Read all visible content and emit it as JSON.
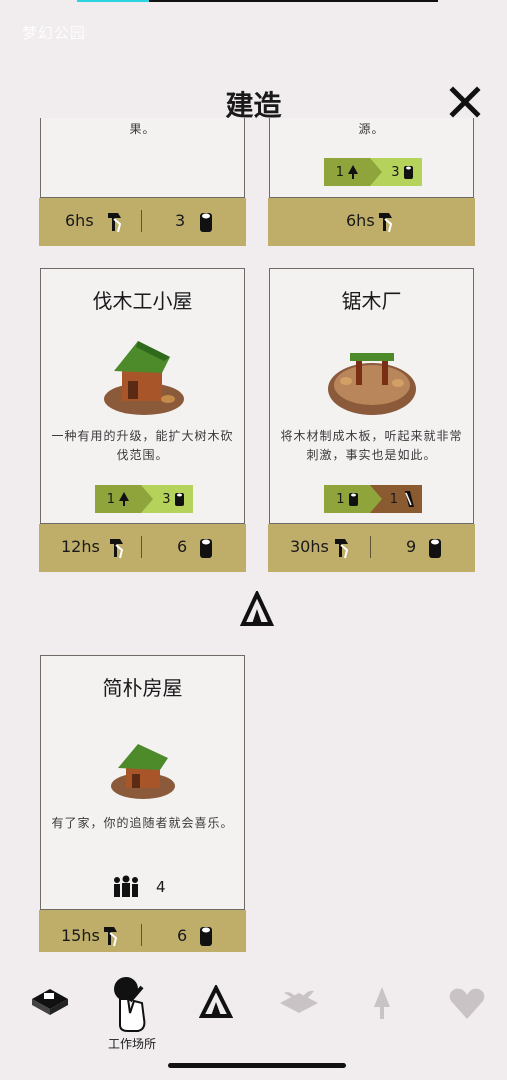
{
  "watermark": "梦幻公园",
  "header": {
    "title": "建造"
  },
  "cards": [
    {
      "desc_tail": "果。",
      "time": "6hs",
      "cost": "3"
    },
    {
      "desc_tail": "源。",
      "tag_left": "1",
      "tag_right": "3",
      "time": "6hs"
    },
    {
      "title": "伐木工小屋",
      "desc": "一种有用的升级，能扩大树木砍伐范围。",
      "tag_left": "1",
      "tag_right": "3",
      "time": "12hs",
      "cost": "6"
    },
    {
      "title": "锯木厂",
      "desc": "将木材制成木板，听起来就非常刺激，事实也是如此。",
      "tag_left": "1",
      "tag_right": "1",
      "time": "30hs",
      "cost": "9"
    },
    {
      "title": "简朴房屋",
      "desc": "有了家，你的追随者就会喜乐。",
      "followers": "4",
      "time": "15hs",
      "cost": "6"
    }
  ],
  "nav": {
    "active_label": "工作场所"
  },
  "icons": [
    "close-icon",
    "hammer-icon",
    "log-icon",
    "tree-icon",
    "board-icon",
    "followers-icon",
    "tent-icon",
    "land-icon",
    "hammer-hand-icon",
    "sprout-icon",
    "heart-icon"
  ]
}
